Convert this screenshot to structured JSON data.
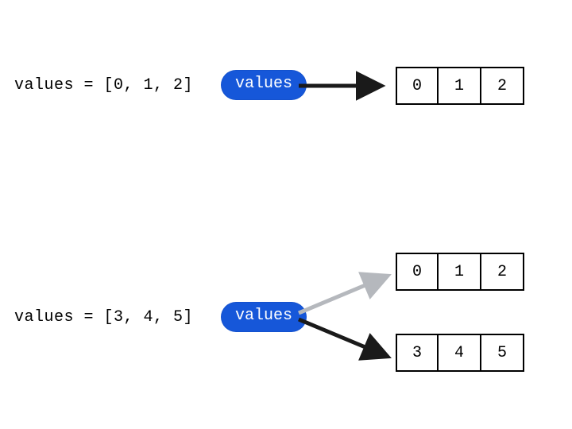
{
  "scene1": {
    "code": "values = [0, 1, 2]",
    "pill_label": "values",
    "cells": [
      "0",
      "1",
      "2"
    ]
  },
  "scene2": {
    "code": "values = [3, 4, 5]",
    "pill_label": "values",
    "old_cells": [
      "0",
      "1",
      "2"
    ],
    "new_cells": [
      "3",
      "4",
      "5"
    ]
  },
  "colors": {
    "pill_bg": "#1657d9",
    "arrow_active": "#1a1a1a",
    "arrow_inactive": "#b5b8bd"
  }
}
